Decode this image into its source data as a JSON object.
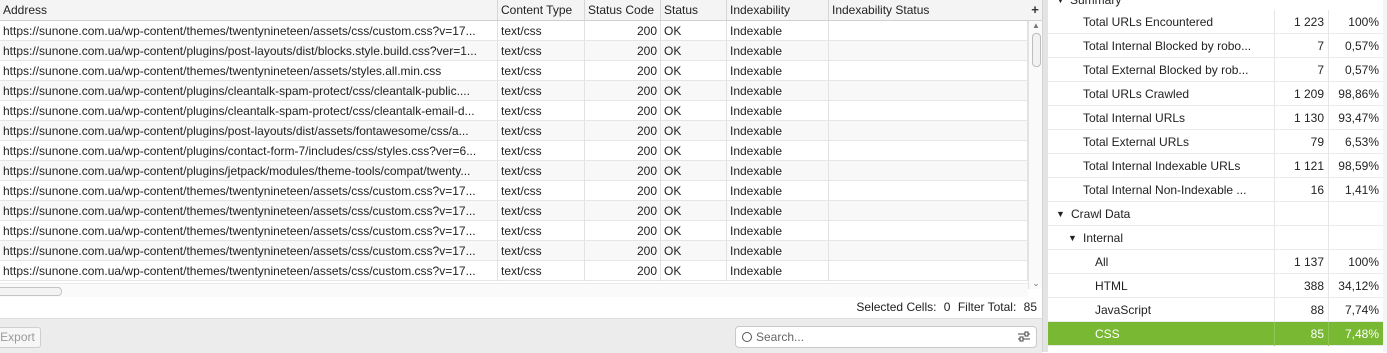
{
  "columns": [
    "Address",
    "Content Type",
    "Status Code",
    "Status",
    "Indexability",
    "Indexability Status"
  ],
  "add_column_glyph": "+",
  "rows": [
    {
      "address": "https://sunone.com.ua/wp-content/themes/twentynineteen/assets/css/custom.css?v=17...",
      "content_type": "text/css",
      "status_code": "200",
      "status": "OK",
      "indexability": "Indexable",
      "indexability_status": ""
    },
    {
      "address": "https://sunone.com.ua/wp-content/plugins/post-layouts/dist/blocks.style.build.css?ver=1...",
      "content_type": "text/css",
      "status_code": "200",
      "status": "OK",
      "indexability": "Indexable",
      "indexability_status": ""
    },
    {
      "address": "https://sunone.com.ua/wp-content/themes/twentynineteen/assets/styles.all.min.css",
      "content_type": "text/css",
      "status_code": "200",
      "status": "OK",
      "indexability": "Indexable",
      "indexability_status": ""
    },
    {
      "address": "https://sunone.com.ua/wp-content/plugins/cleantalk-spam-protect/css/cleantalk-public....",
      "content_type": "text/css",
      "status_code": "200",
      "status": "OK",
      "indexability": "Indexable",
      "indexability_status": ""
    },
    {
      "address": "https://sunone.com.ua/wp-content/plugins/cleantalk-spam-protect/css/cleantalk-email-d...",
      "content_type": "text/css",
      "status_code": "200",
      "status": "OK",
      "indexability": "Indexable",
      "indexability_status": ""
    },
    {
      "address": "https://sunone.com.ua/wp-content/plugins/post-layouts/dist/assets/fontawesome/css/a...",
      "content_type": "text/css",
      "status_code": "200",
      "status": "OK",
      "indexability": "Indexable",
      "indexability_status": ""
    },
    {
      "address": "https://sunone.com.ua/wp-content/plugins/contact-form-7/includes/css/styles.css?ver=6...",
      "content_type": "text/css",
      "status_code": "200",
      "status": "OK",
      "indexability": "Indexable",
      "indexability_status": ""
    },
    {
      "address": "https://sunone.com.ua/wp-content/plugins/jetpack/modules/theme-tools/compat/twenty...",
      "content_type": "text/css",
      "status_code": "200",
      "status": "OK",
      "indexability": "Indexable",
      "indexability_status": ""
    },
    {
      "address": "https://sunone.com.ua/wp-content/themes/twentynineteen/assets/css/custom.css?v=17...",
      "content_type": "text/css",
      "status_code": "200",
      "status": "OK",
      "indexability": "Indexable",
      "indexability_status": ""
    },
    {
      "address": "https://sunone.com.ua/wp-content/themes/twentynineteen/assets/css/custom.css?v=17...",
      "content_type": "text/css",
      "status_code": "200",
      "status": "OK",
      "indexability": "Indexable",
      "indexability_status": ""
    },
    {
      "address": "https://sunone.com.ua/wp-content/themes/twentynineteen/assets/css/custom.css?v=17...",
      "content_type": "text/css",
      "status_code": "200",
      "status": "OK",
      "indexability": "Indexable",
      "indexability_status": ""
    },
    {
      "address": "https://sunone.com.ua/wp-content/themes/twentynineteen/assets/css/custom.css?v=17...",
      "content_type": "text/css",
      "status_code": "200",
      "status": "OK",
      "indexability": "Indexable",
      "indexability_status": ""
    },
    {
      "address": "https://sunone.com.ua/wp-content/themes/twentynineteen/assets/css/custom.css?v=17...",
      "content_type": "text/css",
      "status_code": "200",
      "status": "OK",
      "indexability": "Indexable",
      "indexability_status": ""
    }
  ],
  "status_bar": {
    "selected_label": "Selected Cells:",
    "selected_value": "0",
    "filter_label": "Filter Total:",
    "filter_value": "85"
  },
  "export_label": "Export",
  "search": {
    "placeholder": "Search..."
  },
  "overview": {
    "summary_label": "Summary",
    "items": [
      {
        "label": "Total URLs Encountered",
        "value": "1 223",
        "pct": "100%"
      },
      {
        "label": "Total Internal Blocked by robo...",
        "value": "7",
        "pct": "0,57%"
      },
      {
        "label": "Total External Blocked by rob...",
        "value": "7",
        "pct": "0,57%"
      },
      {
        "label": "Total URLs Crawled",
        "value": "1 209",
        "pct": "98,86%"
      },
      {
        "label": "Total Internal URLs",
        "value": "1 130",
        "pct": "93,47%"
      },
      {
        "label": "Total External URLs",
        "value": "79",
        "pct": "6,53%"
      },
      {
        "label": "Total Internal Indexable URLs",
        "value": "1 121",
        "pct": "98,59%"
      },
      {
        "label": "Total Internal Non-Indexable ...",
        "value": "16",
        "pct": "1,41%"
      }
    ],
    "crawl_data_label": "Crawl Data",
    "internal_label": "Internal",
    "internal_items": [
      {
        "label": "All",
        "value": "1 137",
        "pct": "100%",
        "selected": false
      },
      {
        "label": "HTML",
        "value": "388",
        "pct": "34,12%",
        "selected": false
      },
      {
        "label": "JavaScript",
        "value": "88",
        "pct": "7,74%",
        "selected": false
      },
      {
        "label": "CSS",
        "value": "85",
        "pct": "7,48%",
        "selected": true
      }
    ],
    "selected_color": "#78b832"
  }
}
